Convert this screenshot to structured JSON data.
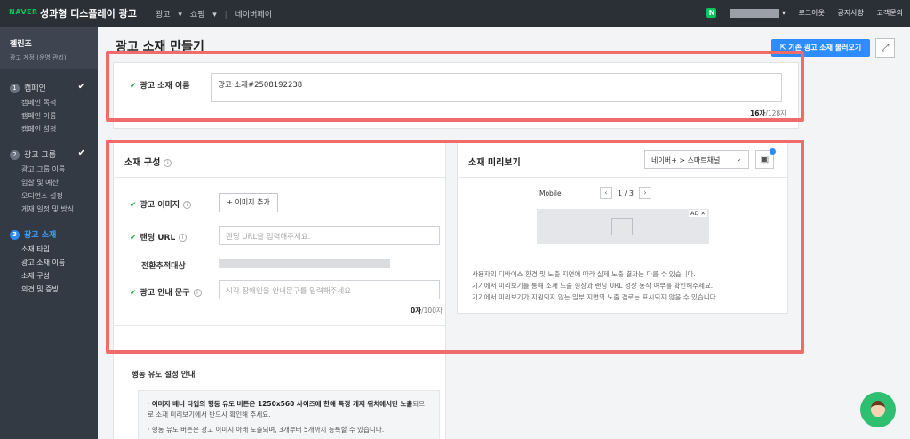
{
  "topbar": {
    "logo": "NAVER",
    "product": "성과형 디스플레이 광고",
    "nav": [
      "광고",
      "쇼핑",
      "네이버페이"
    ],
    "right": [
      "로그아웃",
      "공지사항",
      "고객문의"
    ],
    "user_badge": "N"
  },
  "sidebar": {
    "account_title": "첼린즈",
    "account_sub": "광고 계정 (운영 관리)",
    "steps": [
      {
        "num": "1",
        "title": "캠페인",
        "items": [
          "캠페인 목적",
          "캠페인 이름",
          "캠페인 설정"
        ]
      },
      {
        "num": "2",
        "title": "광고 그룹",
        "items": [
          "광고 그룹 이름",
          "입찰 및 예산",
          "오디언스 설정",
          "게재 일정 및 방식"
        ]
      },
      {
        "num": "3",
        "title": "광고 소재",
        "items": [
          "소재 타입",
          "광고 소재 이름",
          "소재 구성",
          "의견 및 증빙"
        ]
      }
    ],
    "check_icon": "check-icon"
  },
  "main": {
    "title": "광고 소재 만들기",
    "load_button": "기존 광고 소재 불러오기",
    "expand_icon": "expand-icon"
  },
  "name_card": {
    "label": "광고 소재 이름",
    "value": "광고 소재#2508192238",
    "count": "16자",
    "max": "/128자"
  },
  "composition": {
    "title": "소재 구성",
    "image_label": "광고 이미지",
    "add_image": "이미지 추가",
    "landing_label": "랜딩 URL",
    "landing_placeholder": "랜딩 URL을 입력해주세요.",
    "conversion_label": "전환추적대상",
    "guide_label": "광고 안내 문구",
    "guide_placeholder": "시각 장애인을 안내문구를 입력해주세요",
    "guide_count": "0자",
    "guide_max": "/100자",
    "cta_title": "행동 유도 설정 안내",
    "notice_1a": "이미지 배너 타입의 행동 유도 버튼은 1250x560 사이즈에 한해 특정 게재 위치에서만 노출",
    "notice_1b": "되므로 소재 미리보기에서 반드시 확인해 주세요.",
    "notice_2": "행동 유도 버튼은 광고 이미지 아래 노출되며, 3개부터 5개까지 등록할 수 있습니다."
  },
  "preview": {
    "title": "소재 미리보기",
    "select_value": "네이버+ > 스마트채널",
    "mobile_label": "Mobile",
    "page": "1 / 3",
    "ad_tag": "AD ✕",
    "desc_1": "사용자의 디바이스 환경 및 노출 지면에 따라 실제 노출 결과는 다를 수 있습니다.",
    "desc_2": "기기에서 미리보기를 통해 소재 노출 형상과 랜딩 URL 정상 동작 여부를 확인해주세요.",
    "desc_3": "기기에서 미리보기가 지원되지 않는 일부 지면의 노출 경로는 표시되지 않을 수 있습니다."
  },
  "colors": {
    "accent": "#2d8cff",
    "required": "#2ca84b",
    "highlight": "#f06b6b",
    "naver_green": "#03c75a"
  }
}
